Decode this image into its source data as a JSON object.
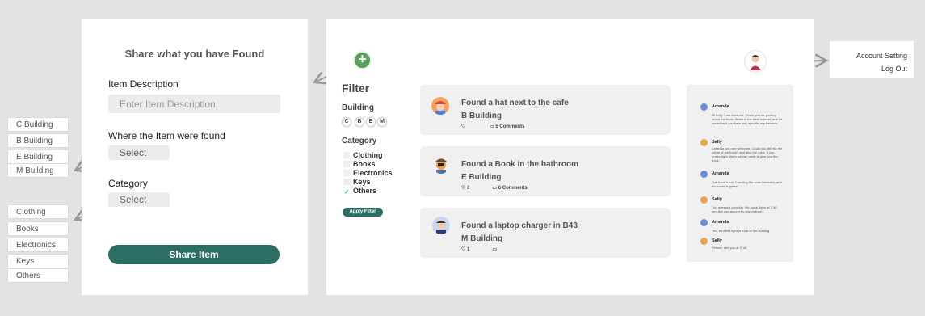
{
  "left_lists": {
    "buildings": [
      "C Building",
      "B Building",
      "E Building",
      "M Building"
    ],
    "categories": [
      "Clothing",
      "Books",
      "Electronics",
      "Keys",
      "Others"
    ]
  },
  "share_form": {
    "title": "Share what you have Found",
    "item_description_label": "Item Description",
    "item_description_placeholder": "Enter Item Description",
    "where_label": "Where the Item were found",
    "where_select": "Select",
    "category_label": "Category",
    "category_select": "Select",
    "submit_label": "Share Item"
  },
  "filter": {
    "title": "Filter",
    "building_label": "Building",
    "building_chips": [
      "C",
      "B",
      "E",
      "M"
    ],
    "category_label": "Category",
    "categories": [
      "Clothing",
      "Books",
      "Electronics",
      "Keys",
      "Others"
    ],
    "checked_category": "Others",
    "apply_label": "Apply Filter"
  },
  "posts": [
    {
      "title": "Found a hat next to the  cafe",
      "location": "B Building",
      "likes": "",
      "comments": "5 Comments"
    },
    {
      "title": "Found a Book in the  bathroom",
      "location": "E Building",
      "likes": "3",
      "comments": "6 Comments"
    },
    {
      "title": "Found a laptop charger in B43",
      "location": "M Building",
      "likes": "1",
      "comments": ""
    }
  ],
  "chat": [
    {
      "name": "Amanda",
      "text": "Hi Sally, I am Amanda. Thank you for posting about the book. When is the best to meet, and let me know if you have any specific requirement."
    },
    {
      "name": "Sally",
      "text": "Amanda, you are welcome. Could you tell me the name of the book? and also the color. If you guess right, them we can meet to give you the book."
    },
    {
      "name": "Amanda",
      "text": "The book is call Cracking the code interview, and the cover is green."
    },
    {
      "name": "Sally",
      "text": "You guessed correctly. My class finish at 3:30 pm. Are you around by any chance?"
    },
    {
      "name": "Amanda",
      "text": "Yes, let meet right in front of the building"
    },
    {
      "name": "Sally",
      "text": "Perfect, see you at 3: 45."
    }
  ],
  "account_menu": {
    "setting": "Account Setting",
    "logout": "Log Out"
  },
  "colors": {
    "accent": "#2d6e64",
    "plus": "#5aa05c"
  }
}
